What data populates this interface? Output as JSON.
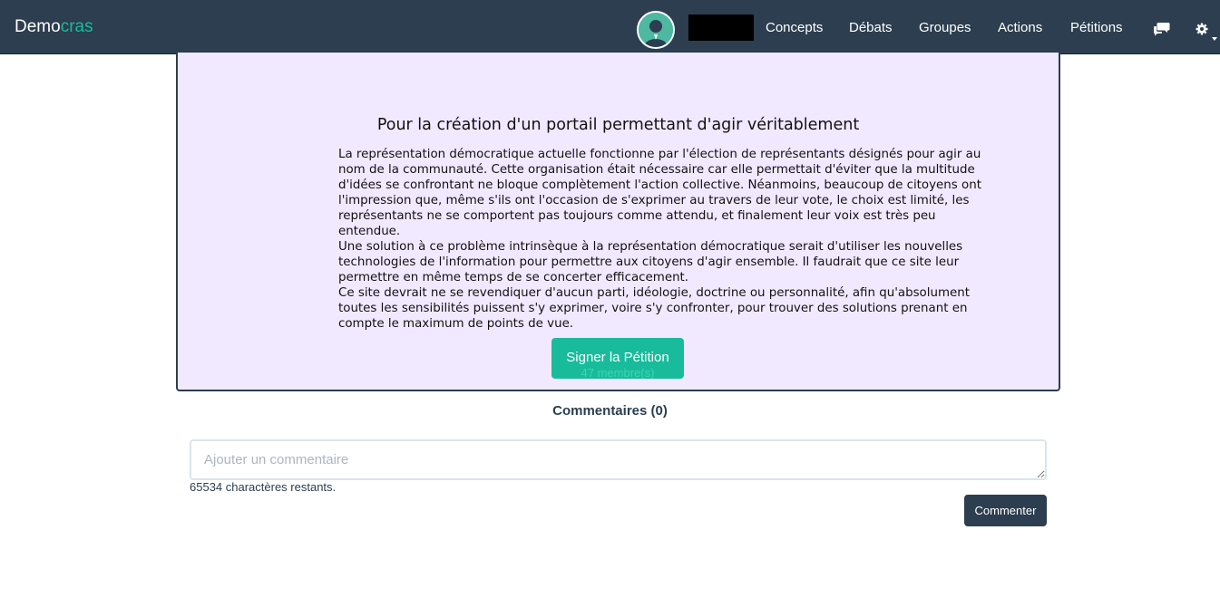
{
  "nav": {
    "brand_main": "Demo",
    "brand_accent": "cras",
    "links": [
      "Concepts",
      "Débats",
      "Groupes",
      "Actions",
      "Pétitions"
    ],
    "icons": [
      "user-avatar",
      "chat-icon",
      "gear-icon",
      "caret-down-icon"
    ],
    "accent_color": "#18bc9c",
    "bar_color": "#2c3e50"
  },
  "petition": {
    "title": "Pour la création d'un portail permettant d'agir véritablement",
    "paragraphs": [
      "La représentation démocratique actuelle fonctionne par l'élection de représentants désignés pour agir au nom de la communauté. Cette organisation était nécessaire car elle permettait d'éviter que la multitude d'idées se confrontant ne bloque complètement l'action collective. Néanmoins, beaucoup de citoyens ont l'impression que, même s'ils ont l'occasion de s'exprimer au travers de leur vote, le choix est limité, les représentants ne se comportent pas toujours comme attendu, et finalement leur voix est très peu entendue.",
      "Une solution à ce problème intrinsèque à la représentation démocratique serait d'utiliser les nouvelles technologies de l'information pour permettre aux citoyens d'agir ensemble. Il faudrait que ce site leur permettre en même temps de se concerter efficacement.",
      "Ce site devrait ne se revendiquer d'aucun parti, idéologie, doctrine ou personnalité, afin qu'absolument toutes les sensibilités puissent s'y exprimer, voire s'y confronter, pour trouver des solutions prenant en compte le maximum de points de vue."
    ],
    "sign_label": "Signer la Pétition",
    "members_label": "47 membre(s)",
    "background_color": "#f1e9ff"
  },
  "comments": {
    "title": "Commentaires (0)",
    "placeholder": "Ajouter un commentaire",
    "chars_left": "65534 charactères restants.",
    "submit_label": "Commenter"
  }
}
